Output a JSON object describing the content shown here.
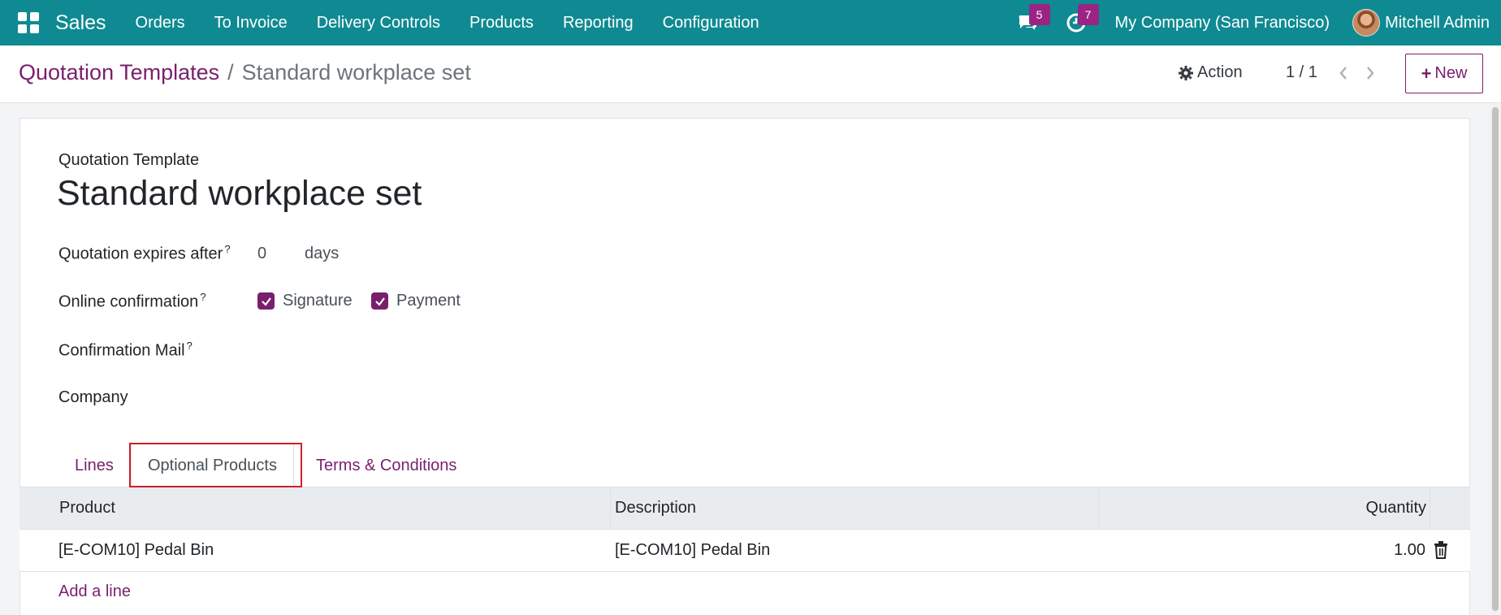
{
  "navbar": {
    "brand": "Sales",
    "menu": [
      "Orders",
      "To Invoice",
      "Delivery Controls",
      "Products",
      "Reporting",
      "Configuration"
    ],
    "messages_count": "5",
    "activities_count": "7",
    "company": "My Company (San Francisco)",
    "user": "Mitchell Admin",
    "bg_color": "#0f8a92"
  },
  "control_panel": {
    "breadcrumb_parent": "Quotation Templates",
    "breadcrumb_separator": "/",
    "breadcrumb_current": "Standard workplace set",
    "action_label": "Action",
    "pager": "1 / 1",
    "new_label": "New"
  },
  "form": {
    "template_label": "Quotation Template",
    "title": "Standard workplace set",
    "expires_label": "Quotation expires after",
    "expires_value": "0",
    "expires_unit": "days",
    "online_confirmation_label": "Online confirmation",
    "signature_label": "Signature",
    "signature_checked": true,
    "payment_label": "Payment",
    "payment_checked": true,
    "confirmation_mail_label": "Confirmation Mail",
    "company_label": "Company",
    "help_marker": "?"
  },
  "tabs": [
    {
      "label": "Lines",
      "active": false
    },
    {
      "label": "Optional Products",
      "active": true
    },
    {
      "label": "Terms & Conditions",
      "active": false
    }
  ],
  "table": {
    "columns": [
      "Product",
      "Description",
      "Quantity"
    ],
    "rows": [
      {
        "product": "[E-COM10] Pedal Bin",
        "description": "[E-COM10] Pedal Bin",
        "quantity": "1.00"
      }
    ],
    "add_line_label": "Add a line"
  },
  "colors": {
    "accent": "#7a1f6c",
    "highlight": "#d01f2c"
  }
}
